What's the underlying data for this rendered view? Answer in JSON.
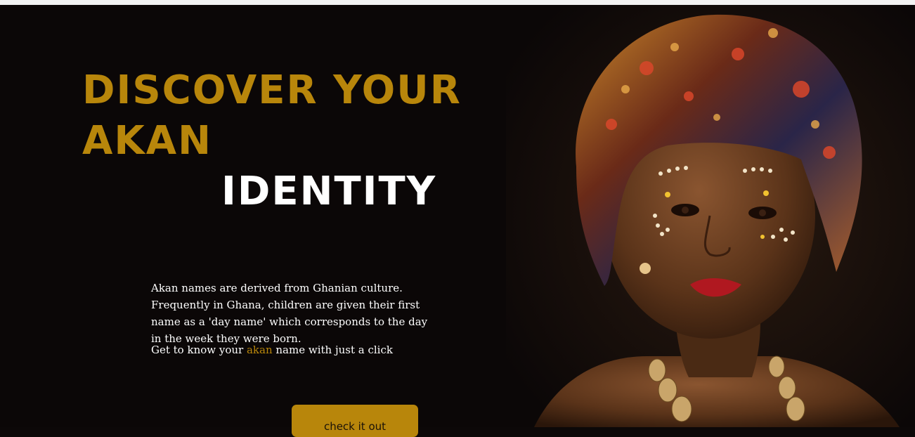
{
  "hero": {
    "headline_line1": "DISCOVER YOUR",
    "headline_line2": "AKAN",
    "headline_line3": "IDENTITY",
    "intro_text": "Akan names are derived from Ghanian culture. Frequently in Ghana, children are given their first name as a 'day name' which corresponds to the day in the week they were born.",
    "cta_prefix": "Get to know your ",
    "cta_highlight": "akan",
    "cta_suffix": " name with just a click",
    "button_label": "check it out"
  },
  "colors": {
    "background": "#0b0707",
    "gold_accent": "#b8860b",
    "text_white": "#ffffff"
  },
  "portrait": {
    "icon": "portrait-image"
  }
}
